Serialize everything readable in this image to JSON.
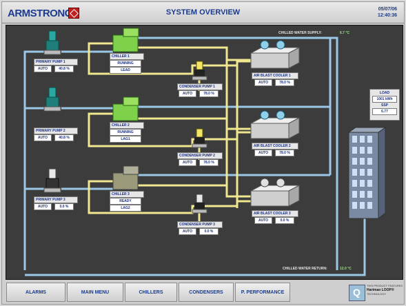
{
  "header": {
    "logo_text": "ARMSTRONG",
    "title": "SYSTEM OVERVIEW",
    "date": "05/07/06",
    "time": "12:40:36"
  },
  "supply": {
    "label": "CHILLED WATER SUPPLY:",
    "value": "6.7 °C"
  },
  "return": {
    "label": "CHILLED WATER RETURN:",
    "value": "12.0 °C"
  },
  "pumps": [
    {
      "label": "PRIMARY PUMP 1",
      "mode": "AUTO",
      "pct": "40.8 %"
    },
    {
      "label": "PRIMARY PUMP 2",
      "mode": "AUTO",
      "pct": "40.8 %"
    },
    {
      "label": "PRIMARY PUMP 3",
      "mode": "AUTO",
      "pct": "0.0 %"
    }
  ],
  "chillers": [
    {
      "label": "CHILLER 1",
      "status": "RUNNING",
      "role": "LEAD"
    },
    {
      "label": "CHILLER 2",
      "status": "RUNNING",
      "role": "LAG1"
    },
    {
      "label": "CHILLER 3",
      "status": "READY",
      "role": "LAG2"
    }
  ],
  "condenser_pumps": [
    {
      "label": "CONDENSER PUMP 1",
      "mode": "AUTO",
      "pct": "78.0 %"
    },
    {
      "label": "CONDENSER PUMP 2",
      "mode": "AUTO",
      "pct": "78.0 %"
    },
    {
      "label": "CONDENSER PUMP 3",
      "mode": "AUTO",
      "pct": "0.0 %"
    }
  ],
  "coolers": [
    {
      "label": "AIR BLAST COOLER 1",
      "mode": "AUTO",
      "pct": "78.0 %"
    },
    {
      "label": "AIR BLAST COOLER 2",
      "mode": "AUTO",
      "pct": "78.0 %"
    },
    {
      "label": "AIR BLAST COOLER 3",
      "mode": "AUTO",
      "pct": "0.0 %"
    }
  ],
  "load": {
    "label": "LOAD",
    "value": "1001 kWh",
    "sp_label": "SSP",
    "sp_value": "6.77"
  },
  "footer": {
    "buttons": [
      "ALARMS",
      "MAIN MENU",
      "CHILLERS",
      "CONDENSERS",
      "P. PERFORMANCE"
    ],
    "product_text_1": "THIS PRODUCT FEATURES",
    "product_text_2": "Hartman LOOP®",
    "product_text_3": "TECHNOLOGY"
  },
  "colors": {
    "chilled_pipe": "#9cc8e8",
    "condenser_pipe": "#f0e890",
    "chiller_green": "#7fd04a",
    "panel_bg": "#3c3c3c",
    "accent_text": "#1a3a8a"
  }
}
